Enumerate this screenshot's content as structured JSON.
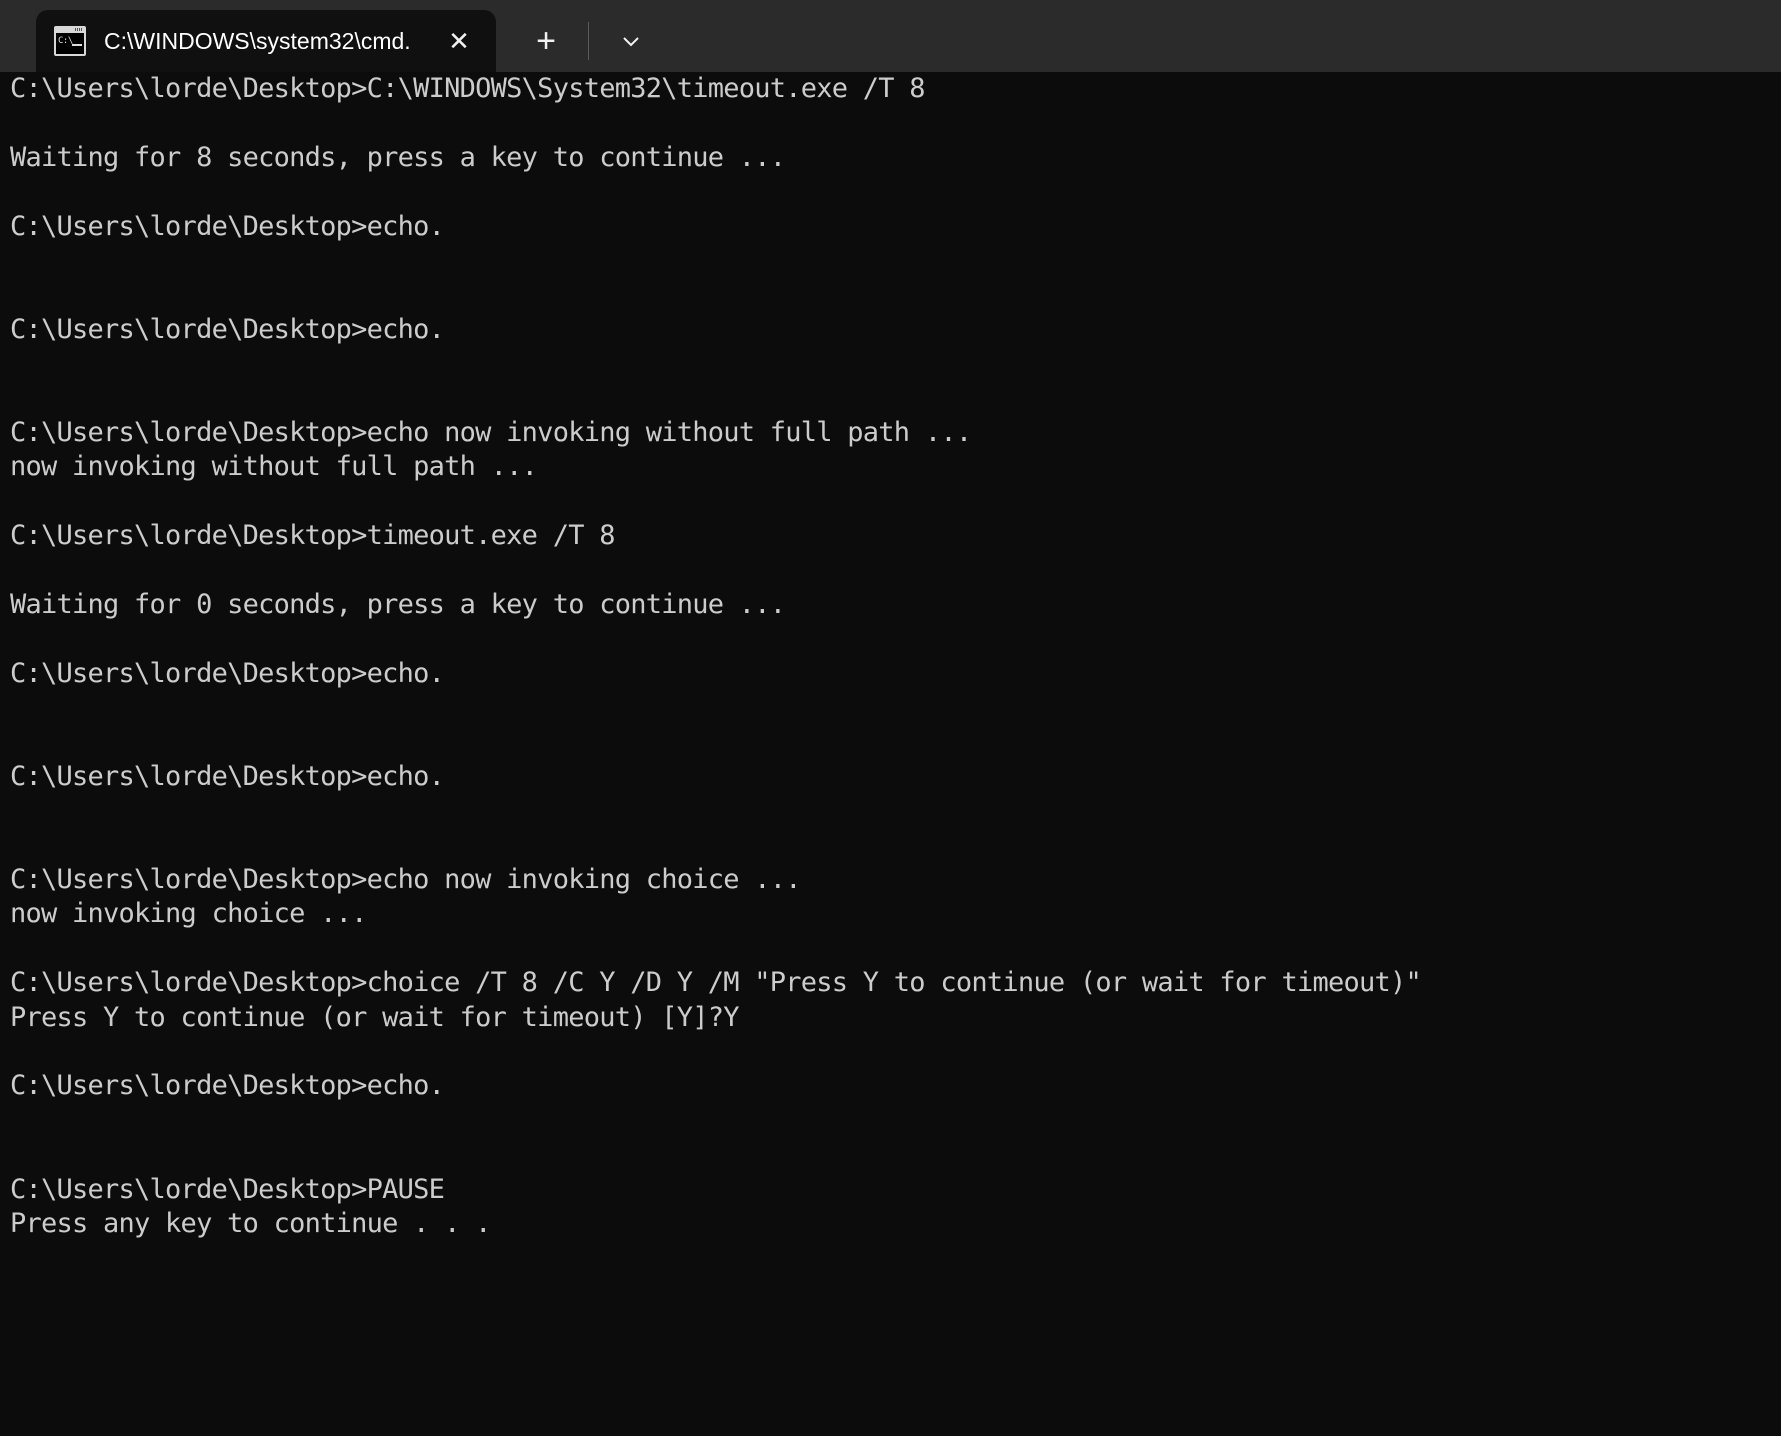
{
  "window": {
    "titlebar_color": "#2b2b2b",
    "terminal_bg": "#0c0c0c",
    "terminal_fg": "#cccccc"
  },
  "tab": {
    "title": "C:\\WINDOWS\\system32\\cmd.",
    "icon_name": "cmd-console-icon",
    "icon_prompt_text": "C:\\",
    "close_label": "✕"
  },
  "toolbar": {
    "new_tab_label": "+",
    "dropdown_label": "⌄"
  },
  "terminal": {
    "prompt": "C:\\Users\\lorde\\Desktop>",
    "lines": [
      "C:\\Users\\lorde\\Desktop>C:\\WINDOWS\\System32\\timeout.exe /T 8",
      "",
      "Waiting for 8 seconds, press a key to continue ...",
      "",
      "C:\\Users\\lorde\\Desktop>echo.",
      "",
      "",
      "C:\\Users\\lorde\\Desktop>echo.",
      "",
      "",
      "C:\\Users\\lorde\\Desktop>echo now invoking without full path ...",
      "now invoking without full path ...",
      "",
      "C:\\Users\\lorde\\Desktop>timeout.exe /T 8",
      "",
      "Waiting for 0 seconds, press a key to continue ...",
      "",
      "C:\\Users\\lorde\\Desktop>echo.",
      "",
      "",
      "C:\\Users\\lorde\\Desktop>echo.",
      "",
      "",
      "C:\\Users\\lorde\\Desktop>echo now invoking choice ...",
      "now invoking choice ...",
      "",
      "C:\\Users\\lorde\\Desktop>choice /T 8 /C Y /D Y /M \"Press Y to continue (or wait for timeout)\"",
      "Press Y to continue (or wait for timeout) [Y]?Y",
      "",
      "C:\\Users\\lorde\\Desktop>echo.",
      "",
      "",
      "C:\\Users\\lorde\\Desktop>PAUSE",
      "Press any key to continue . . ."
    ]
  }
}
